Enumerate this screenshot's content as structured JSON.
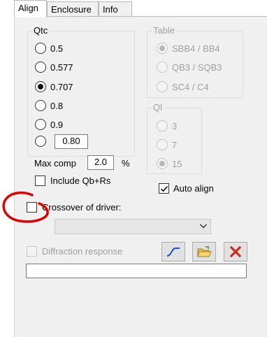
{
  "tabs": [
    "Align",
    "Enclosure",
    "Info"
  ],
  "qtc": {
    "title": "Qtc",
    "options": [
      "0.5",
      "0.577",
      "0.707",
      "0.8",
      "0.9"
    ],
    "selected": "0.707",
    "custom_value": "0.80"
  },
  "max_comp": {
    "label": "Max comp",
    "value": "2.0",
    "unit": "%"
  },
  "include_qb_rs": {
    "label": "Include Qb+Rs",
    "checked": false
  },
  "table": {
    "title": "Table",
    "options": [
      "SBB4 / BB4",
      "QB3 / SQB3",
      "SC4 / C4"
    ],
    "selected": "SBB4 / BB4"
  },
  "ql": {
    "title": "Ql",
    "options": [
      "3",
      "7",
      "15"
    ],
    "selected": "15"
  },
  "auto_align": {
    "label": "Auto align",
    "checked": true
  },
  "crossover": {
    "label": "Crossover of driver:",
    "checked": false,
    "combo_value": ""
  },
  "diffraction": {
    "label": "Diffraction response",
    "checked": false,
    "value": ""
  },
  "colors": {
    "annotation_circle": "#e00000",
    "curve_icon": "#1f4fd8",
    "delete_icon": "#d42a1e",
    "folder_icon": "#e8c14a"
  }
}
